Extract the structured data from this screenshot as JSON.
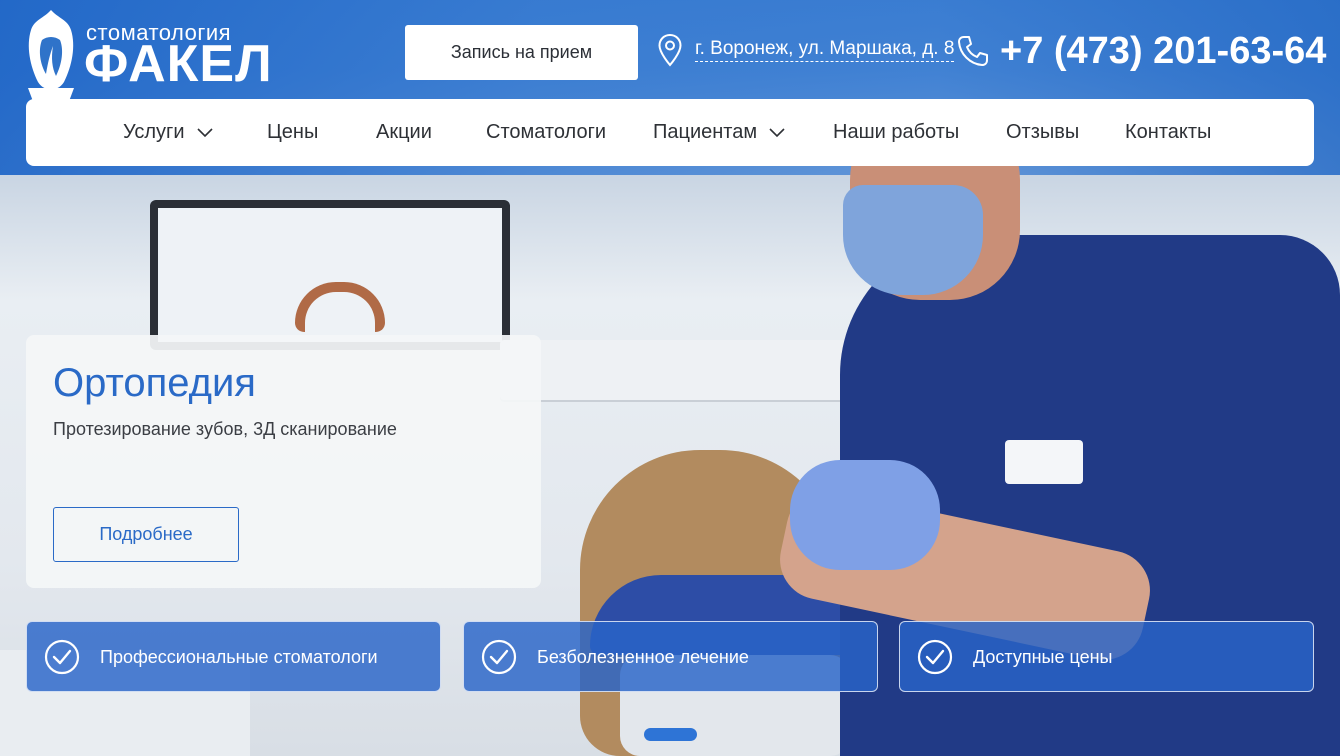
{
  "brand": {
    "subtitle": "стоматология",
    "name": "ФАКЕЛ",
    "logo_icon": "tooth-torch-icon",
    "color_primary": "#2a6ac7",
    "color_white": "#ffffff"
  },
  "header": {
    "appointment_label": "Запись на прием",
    "address": "г. Воронеж, ул. Маршака, д. 8",
    "address_icon": "location-pin-icon",
    "phone": "+7 (473) 201-63-64",
    "phone_icon": "phone-icon"
  },
  "nav": {
    "items": [
      {
        "label": "Услуги",
        "dropdown": true
      },
      {
        "label": "Цены",
        "dropdown": false
      },
      {
        "label": "Акции",
        "dropdown": false
      },
      {
        "label": "Стоматологи",
        "dropdown": false
      },
      {
        "label": "Пациентам",
        "dropdown": true
      },
      {
        "label": "Наши работы",
        "dropdown": false
      },
      {
        "label": "Отзывы",
        "dropdown": false
      },
      {
        "label": "Контакты",
        "dropdown": false
      }
    ]
  },
  "promo": {
    "title": "Ортопедия",
    "subtitle": "Протезирование зубов, 3Д сканирование",
    "more_label": "Подробнее"
  },
  "features": [
    {
      "label": "Профессиональные стоматологи",
      "icon": "check-circle-icon"
    },
    {
      "label": "Безболезненное лечение",
      "icon": "check-circle-icon"
    },
    {
      "label": "Доступные цены",
      "icon": "check-circle-icon"
    }
  ],
  "slider": {
    "active_slide": 1,
    "indicator_color": "#2e74d6"
  }
}
